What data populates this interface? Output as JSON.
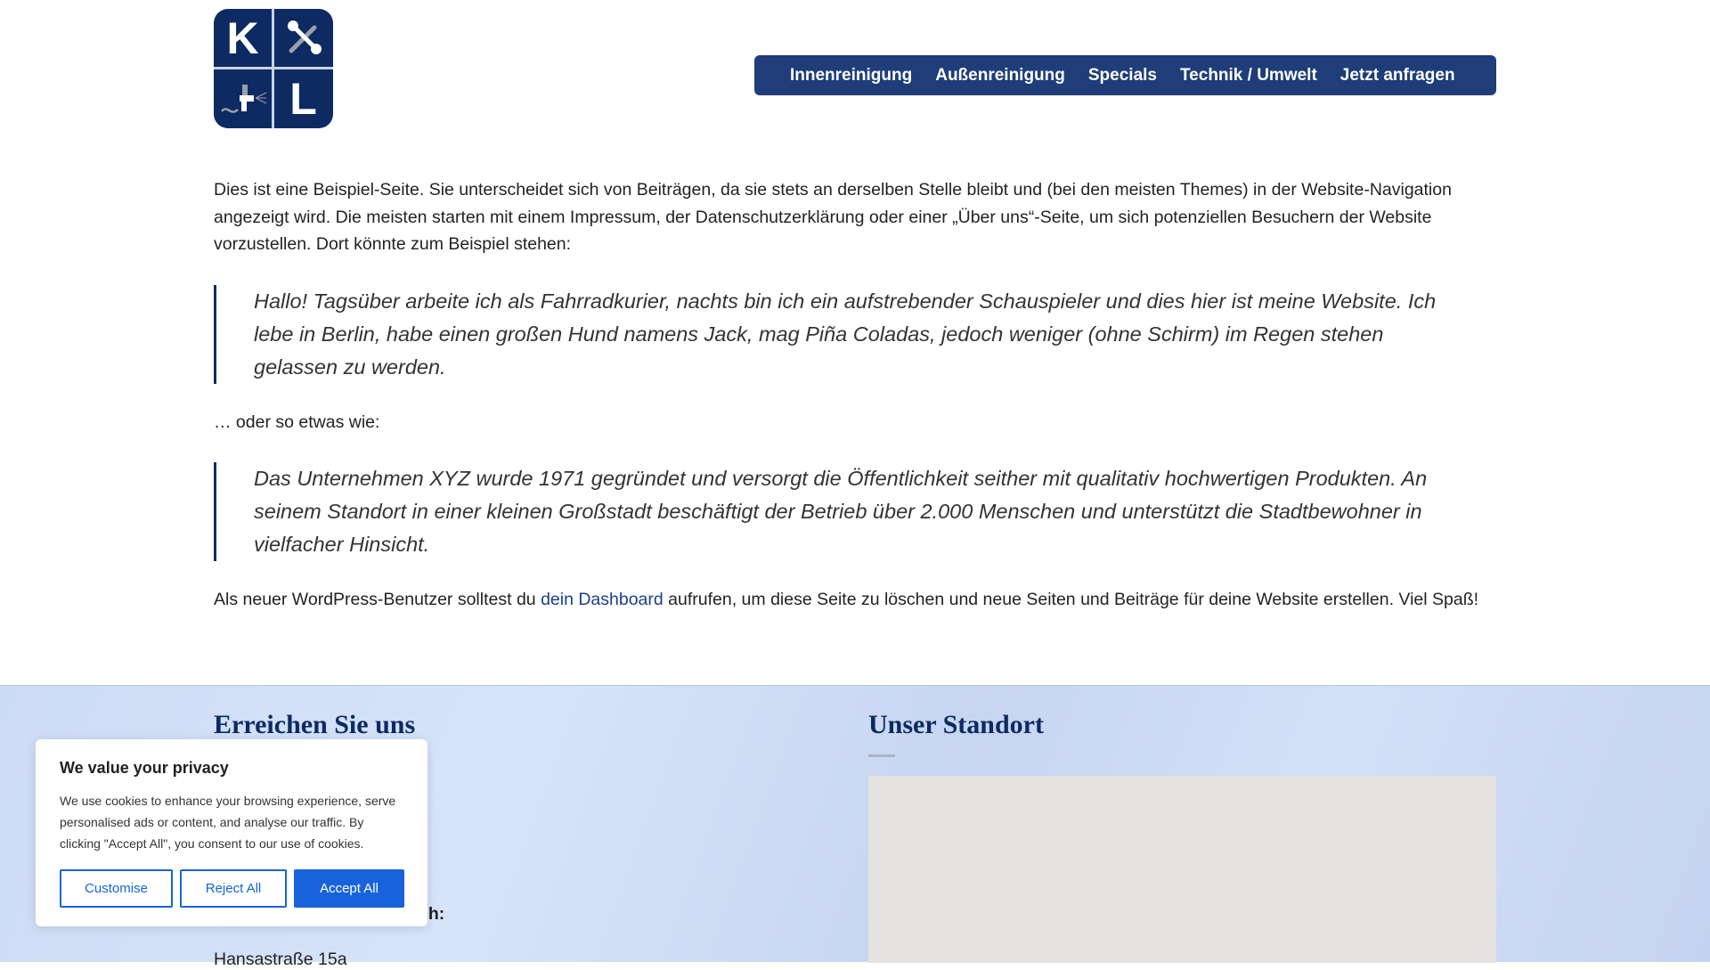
{
  "logo": {
    "letters": [
      "K",
      "L"
    ]
  },
  "nav": {
    "items": [
      "Innenreinigung",
      "Außenreinigung",
      "Specials",
      "Technik / Umwelt",
      "Jetzt anfragen"
    ]
  },
  "content": {
    "intro": "Dies ist eine Beispiel-Seite. Sie unterscheidet sich von Beiträgen, da sie stets an derselben Stelle bleibt und (bei den meisten Themes) in der Website-Navigation angezeigt wird. Die meisten starten mit einem Impressum, der Datenschutzerklärung oder einer „Über uns“-Seite, um sich potenziellen Besuchern der Website vorzustellen. Dort könnte zum Beispiel stehen:",
    "quote1": "Hallo! Tagsüber arbeite ich als Fahrradkurier, nachts bin ich ein aufstrebender Schauspieler und dies hier ist meine Website. Ich lebe in Berlin, habe einen großen Hund namens Jack, mag Piña Coladas, jedoch weniger (ohne Schirm) im Regen stehen gelassen zu werden.",
    "middle": "… oder so etwas wie:",
    "quote2": "Das Unternehmen XYZ wurde 1971 gegründet und versorgt die Öffentlichkeit seither mit qualitativ hochwertigen Produkten. An seinem Standort in einer kleinen Großstadt beschäftigt der Betrieb über 2.000 Menschen und unterstützt die Stadtbewohner in vielfacher Hinsicht.",
    "outro_before": "Als neuer WordPress-Benutzer solltest du ",
    "outro_link": "dein Dashboard",
    "outro_after": " aufrufen, um diese Seite zu löschen und neue Seiten und Beiträge für deine Website erstellen. Viel Spaß!"
  },
  "footer": {
    "contact_title": "Erreichen Sie uns",
    "location_title": "Unser Standort",
    "partial_label": "ch:",
    "street": "Hansastraße 15a"
  },
  "cookie": {
    "title": "We value your privacy",
    "text": "We use cookies to enhance your browsing experience, serve personalised ads or content, and analyse our traffic. By clicking \"Accept All\", you consent to our use of cookies.",
    "customise": "Customise",
    "reject": "Reject All",
    "accept": "Accept All"
  },
  "colors": {
    "brand": "#1f3d78",
    "logo": "#0d2a63",
    "cookie_accent": "#1863dc"
  }
}
